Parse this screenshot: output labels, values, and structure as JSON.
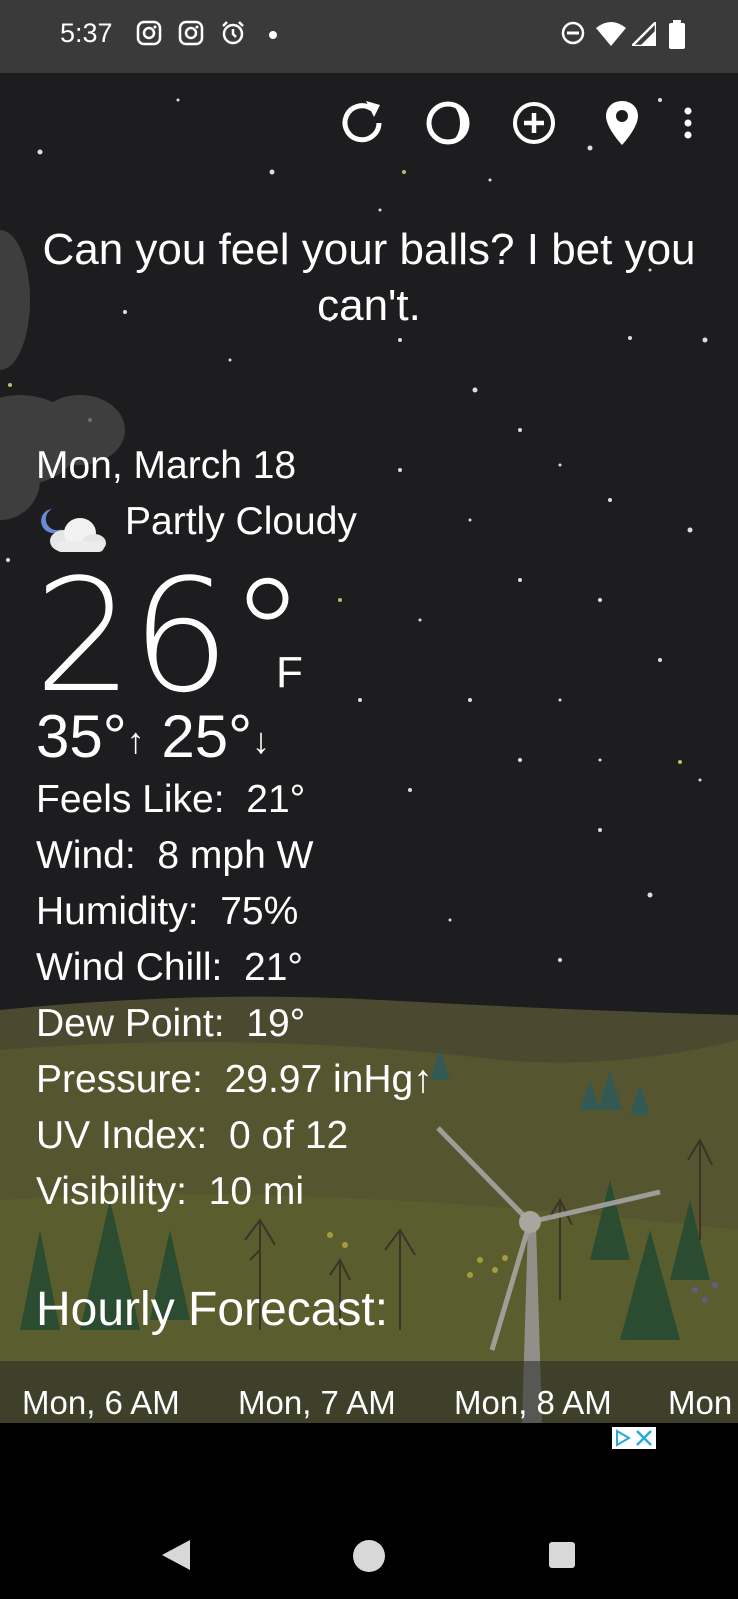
{
  "status_bar": {
    "time": "5:37",
    "icons": [
      "instagram-icon",
      "instagram-icon",
      "alarm-icon",
      "dot-icon",
      "do-not-disturb-icon",
      "wifi-icon",
      "signal-icon",
      "battery-icon"
    ]
  },
  "toolbar": {
    "icons": [
      "refresh-icon",
      "moon-phase-icon",
      "add-location-icon",
      "location-pin-icon",
      "more-vert-icon"
    ]
  },
  "quote": "Can you feel your balls? I bet you can't.",
  "weather": {
    "date": "Mon, March 18",
    "condition": "Partly Cloudy",
    "condition_icon": "partly-cloudy-night-icon",
    "temperature": "26°",
    "unit": "F",
    "high": "35°",
    "low": "25°"
  },
  "details": [
    {
      "label": "Feels Like:",
      "value": "21°"
    },
    {
      "label": "Wind:",
      "value": "8 mph W"
    },
    {
      "label": "Humidity:",
      "value": "75%"
    },
    {
      "label": "Wind Chill:",
      "value": "21°"
    },
    {
      "label": "Dew Point:",
      "value": "19°"
    },
    {
      "label": "Pressure:",
      "value": "29.97 inHg↑"
    },
    {
      "label": "UV Index:",
      "value": "0 of 12"
    },
    {
      "label": "Visibility:",
      "value": "10 mi"
    }
  ],
  "hourly": {
    "title": "Hourly Forecast:",
    "hours": [
      "Mon, 6 AM",
      "Mon, 7 AM",
      "Mon, 8 AM",
      "Mon"
    ]
  },
  "colors": {
    "status_bar": "#3a3a3a",
    "sky": "#1d1d1f",
    "grass": "#4a4a2e",
    "text": "#ffffff"
  }
}
